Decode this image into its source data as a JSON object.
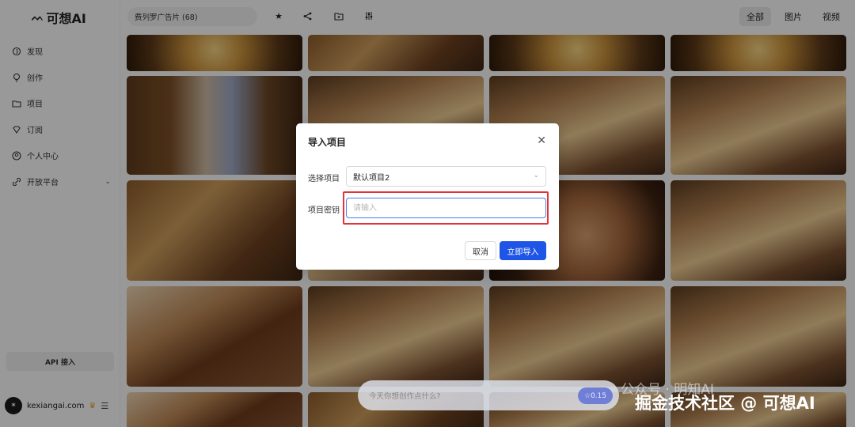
{
  "app": {
    "logo_text": "可想AI",
    "logo_icon": "eyelash-icon"
  },
  "sidebar": {
    "items": [
      {
        "label": "发现",
        "icon": "compass-icon"
      },
      {
        "label": "创作",
        "icon": "bulb-icon"
      },
      {
        "label": "项目",
        "icon": "folder-icon"
      },
      {
        "label": "订阅",
        "icon": "diamond-icon"
      },
      {
        "label": "个人中心",
        "icon": "user-icon"
      },
      {
        "label": "开放平台",
        "icon": "link-icon"
      }
    ],
    "api_label": "API 接入",
    "user_name": "kexiangai.com"
  },
  "topbar": {
    "project_name": "费列罗广告片 (68)",
    "tools": [
      "star-icon",
      "share-icon",
      "folder-add-icon",
      "sliders-icon"
    ],
    "tabs": [
      {
        "label": "全部",
        "active": true
      },
      {
        "label": "图片",
        "active": false
      },
      {
        "label": "视频",
        "active": false
      }
    ]
  },
  "prompt_bar": {
    "placeholder": "今天你想创作点什么?",
    "credit": "☆0.15"
  },
  "watermark": {
    "line1": "公众号 · 明知AI",
    "line2": "掘金技术社区 @ 可想AI"
  },
  "modal": {
    "title": "导入项目",
    "select_label": "选择项目",
    "select_value": "默认项目2",
    "key_label": "项目密钥",
    "key_placeholder": "请输入",
    "cancel_label": "取消",
    "import_label": "立即导入"
  }
}
